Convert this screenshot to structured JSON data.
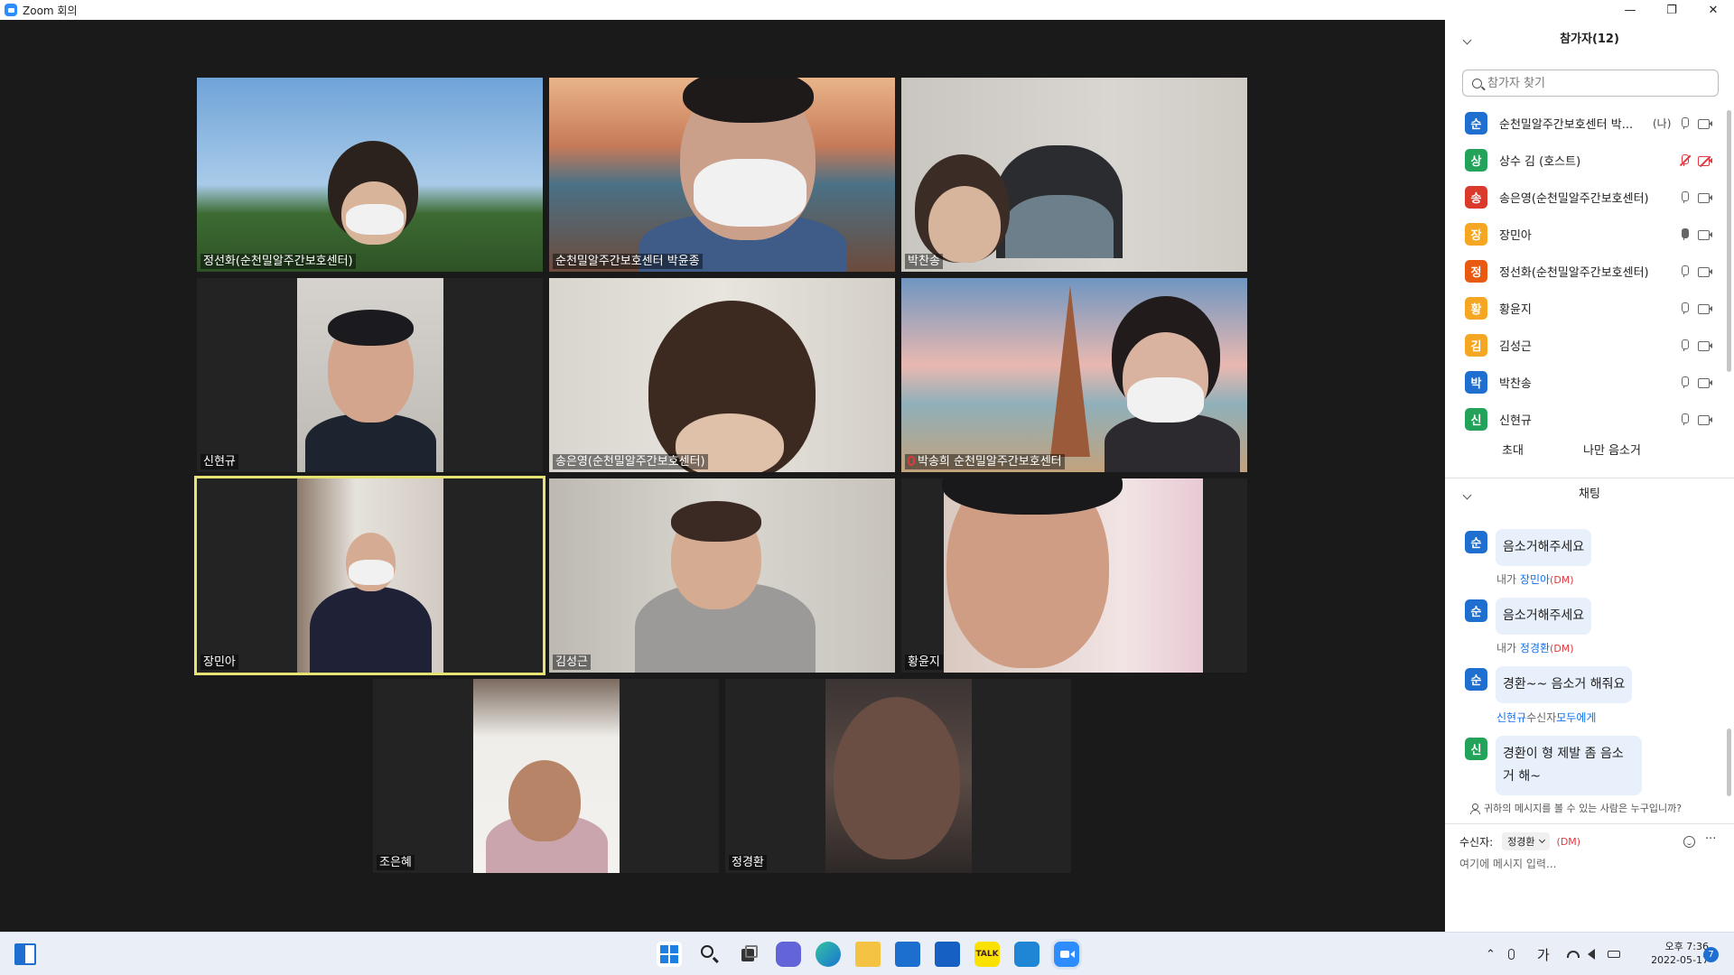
{
  "window": {
    "title": "Zoom 회의",
    "controls": {
      "minimize": "—",
      "restore": "❐",
      "close": "✕"
    }
  },
  "videos": [
    {
      "name": "정선화(순천밀알주간보호센터)"
    },
    {
      "name": "순천밀알주간보호센터 박윤종"
    },
    {
      "name": "박찬송"
    },
    {
      "name": "신현규"
    },
    {
      "name": "송은영(순천밀알주간보호센터)"
    },
    {
      "name": "박송희 순천밀알주간보호센터",
      "mic_muted": true
    },
    {
      "name": "장민아",
      "active_speaker": true
    },
    {
      "name": "김성근"
    },
    {
      "name": "황윤지"
    },
    {
      "name": "조은혜"
    },
    {
      "name": "정경환"
    }
  ],
  "participants_panel": {
    "title": "참가자(12)",
    "search_placeholder": "참가자 찾기",
    "items": [
      {
        "initial": "순",
        "name": "순천밀알주간보호센터 박...",
        "tag": "(나)",
        "color": "#1f6fd1",
        "mic": "on",
        "camera": "on"
      },
      {
        "initial": "상",
        "name": "상수 김 (호스트)",
        "tag": "",
        "color": "#23a35a",
        "mic": "muted",
        "camera": "muted"
      },
      {
        "initial": "송",
        "name": "송은영(순천밀알주간보호센터)",
        "tag": "",
        "color": "#d93a2b",
        "mic": "on",
        "camera": "on"
      },
      {
        "initial": "장",
        "name": "장민아",
        "tag": "",
        "color": "#f5a623",
        "mic": "active",
        "camera": "on"
      },
      {
        "initial": "정",
        "name": "정선화(순천밀알주간보호센터)",
        "tag": "",
        "color": "#e85a12",
        "mic": "on",
        "camera": "on"
      },
      {
        "initial": "황",
        "name": "황윤지",
        "tag": "",
        "color": "#f5a623",
        "mic": "on",
        "camera": "on"
      },
      {
        "initial": "김",
        "name": "김성근",
        "tag": "",
        "color": "#f5a623",
        "mic": "on",
        "camera": "on"
      },
      {
        "initial": "박",
        "name": "박찬송",
        "tag": "",
        "color": "#1f6fd1",
        "mic": "on",
        "camera": "on"
      },
      {
        "initial": "신",
        "name": "신현규",
        "tag": "",
        "color": "#23a35a",
        "mic": "on",
        "camera": "on"
      }
    ],
    "invite_label": "초대",
    "mute_me_label": "나만 음소거"
  },
  "chat_panel": {
    "title": "채팅",
    "messages": [
      {
        "initial": "순",
        "color": "#1f6fd1",
        "meta_prefix": "",
        "meta_target": "",
        "meta_suffix": "",
        "text_lines": [
          "음소거해주세요"
        ]
      },
      {
        "initial": "순",
        "color": "#1f6fd1",
        "meta_prefix": "내가 ",
        "meta_target": "장민아",
        "meta_suffix": "(DM)",
        "text_lines": [
          "음소거해주세요"
        ]
      },
      {
        "initial": "순",
        "color": "#1f6fd1",
        "meta_prefix": "내가 ",
        "meta_target": "정경환",
        "meta_suffix": "(DM)",
        "text_lines": [
          "경환~~ 음소거 해줘요"
        ]
      },
      {
        "initial": "신",
        "color": "#23a35a",
        "meta_prefix": "",
        "meta_target": "신현규",
        "meta_mid": "수신자",
        "meta_target2": "모두에게",
        "meta_suffix": "",
        "text_lines": [
          "경환이 형 제발 좀 음소",
          "거 해~"
        ]
      }
    ],
    "who_can_see": "귀하의 메시지를 볼 수 있는 사람은 누구입니까?",
    "recipient_label": "수신자:",
    "recipient_value": "정경환",
    "recipient_dm": "(DM)",
    "input_placeholder": "여기에 메시지 입력...",
    "more_label": "···"
  },
  "taskbar": {
    "ime": "가",
    "time": "오후 7:36",
    "date": "2022-05-17",
    "notifications": "7",
    "app_icons": [
      "windows-start",
      "search",
      "task-view",
      "teams-chat",
      "edge",
      "file-explorer",
      "microsoft-store",
      "mail",
      "kakaotalk",
      "app-q",
      "zoom"
    ]
  }
}
